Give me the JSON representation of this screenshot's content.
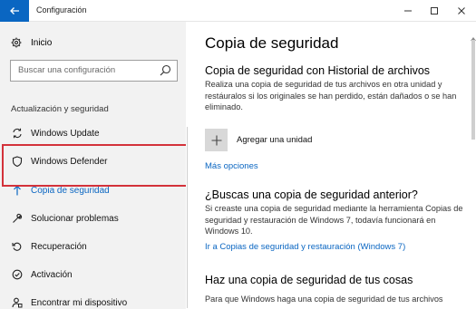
{
  "window": {
    "title": "Configuración"
  },
  "sidebar": {
    "home_label": "Inicio",
    "search_placeholder": "Buscar una configuración",
    "section_label": "Actualización y seguridad",
    "items": [
      {
        "label": "Windows Update",
        "icon": "sync-icon"
      },
      {
        "label": "Windows Defender",
        "icon": "shield-icon"
      },
      {
        "label": "Copia de seguridad",
        "icon": "backup-arrow-icon",
        "active": true
      },
      {
        "label": "Solucionar problemas",
        "icon": "wrench-icon"
      },
      {
        "label": "Recuperación",
        "icon": "recovery-icon"
      },
      {
        "label": "Activación",
        "icon": "activation-check-icon"
      },
      {
        "label": "Encontrar mi dispositivo",
        "icon": "person-device-icon"
      }
    ]
  },
  "main": {
    "title": "Copia de seguridad",
    "file_history": {
      "heading": "Copia de seguridad con Historial de archivos",
      "description": "Realiza una copia de seguridad de tus archivos en otra unidad y restáuralos si los originales se han perdido, están dañados o se han eliminado.",
      "add_drive_label": "Agregar una unidad",
      "more_options": "Más opciones"
    },
    "older_backup": {
      "heading": "¿Buscas una copia de seguridad anterior?",
      "description": "Si creaste una copia de seguridad mediante la herramienta Copias de seguridad y restauración de Windows 7, todavía funcionará en Windows 10.",
      "link": "Ir a Copias de seguridad y restauración (Windows 7)"
    },
    "make_backup": {
      "heading": "Haz una copia de seguridad de tus cosas",
      "description": "Para que Windows haga una copia de seguridad de tus archivos"
    }
  },
  "colors": {
    "accent": "#0a66c2",
    "highlight": "#d3323a",
    "sidebar_bg": "#f2f2f2"
  }
}
